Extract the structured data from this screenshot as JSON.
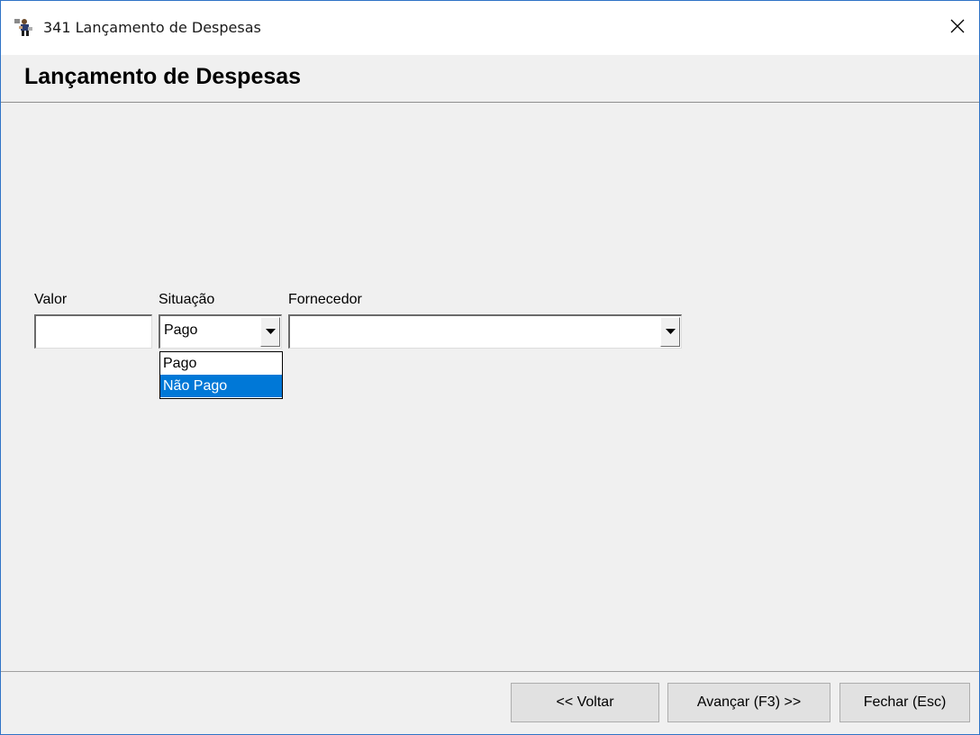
{
  "window": {
    "title": "341 Lançamento de Despesas",
    "icon": "app-icon",
    "close_icon": "close-icon"
  },
  "header": {
    "title": "Lançamento de Despesas"
  },
  "form": {
    "valor": {
      "label": "Valor",
      "value": ""
    },
    "situacao": {
      "label": "Situação",
      "value": "Pago",
      "options": [
        "Pago",
        "Não Pago"
      ],
      "highlighted": "Não Pago"
    },
    "fornecedor": {
      "label": "Fornecedor",
      "value": ""
    }
  },
  "buttons": {
    "voltar": "<< Voltar",
    "avancar": "Avançar (F3) >>",
    "fechar": "Fechar (Esc)"
  },
  "colors": {
    "accent": "#0078d7",
    "window_border": "#2f73c6",
    "background": "#f0f0f0"
  }
}
